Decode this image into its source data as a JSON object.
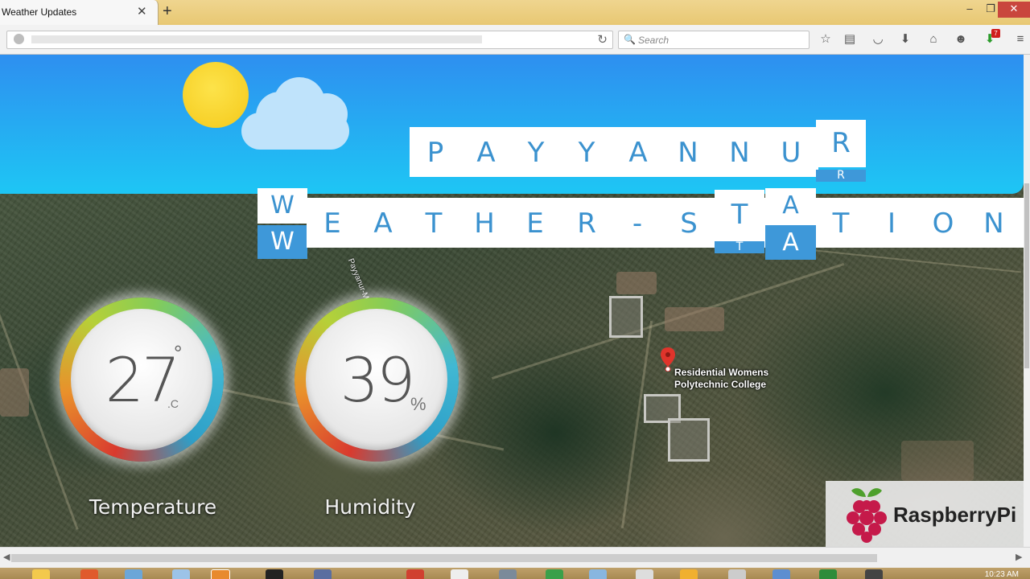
{
  "browser": {
    "tab_title": "Weather Updates",
    "tab_close": "✕",
    "new_tab": "+",
    "window_controls": [
      "‒",
      "❐",
      "✕"
    ],
    "search_placeholder": "Search",
    "reload_symbol": "↻",
    "toolbar_icons": [
      "star-icon",
      "reading-list-icon",
      "pocket-icon",
      "download-icon",
      "home-icon",
      "chat-icon",
      "addon-icon",
      "menu-icon"
    ],
    "addon_badge": "7"
  },
  "page": {
    "title_row1": [
      "P",
      "A",
      "Y",
      "Y",
      "A",
      "N",
      "N",
      "U",
      "R"
    ],
    "title_row2": [
      "W",
      "E",
      "A",
      "T",
      "H",
      "E",
      "R",
      "-",
      "S",
      "T",
      "A",
      "T",
      "I",
      "O",
      "N"
    ],
    "temperature": {
      "value": "27",
      "degree": "°",
      "unit": ".C",
      "label": "Temperature"
    },
    "humidity": {
      "value": "39",
      "unit": "%",
      "label": "Humidity"
    },
    "map_place": [
      "Residential Womens",
      "Polytechnic College"
    ],
    "road_label": "Payyanur-Maniyara",
    "brand": "RaspberryPi"
  },
  "taskbar": {
    "clock": "10:23 AM"
  },
  "colors": {
    "sky_top": "#2e8ff0",
    "sky_bottom": "#1ec6f4",
    "tile_text": "#3b92cf",
    "tile_blue": "#3e98d9",
    "sun": "#f4c91a",
    "cloud": "#bfe3fb"
  }
}
